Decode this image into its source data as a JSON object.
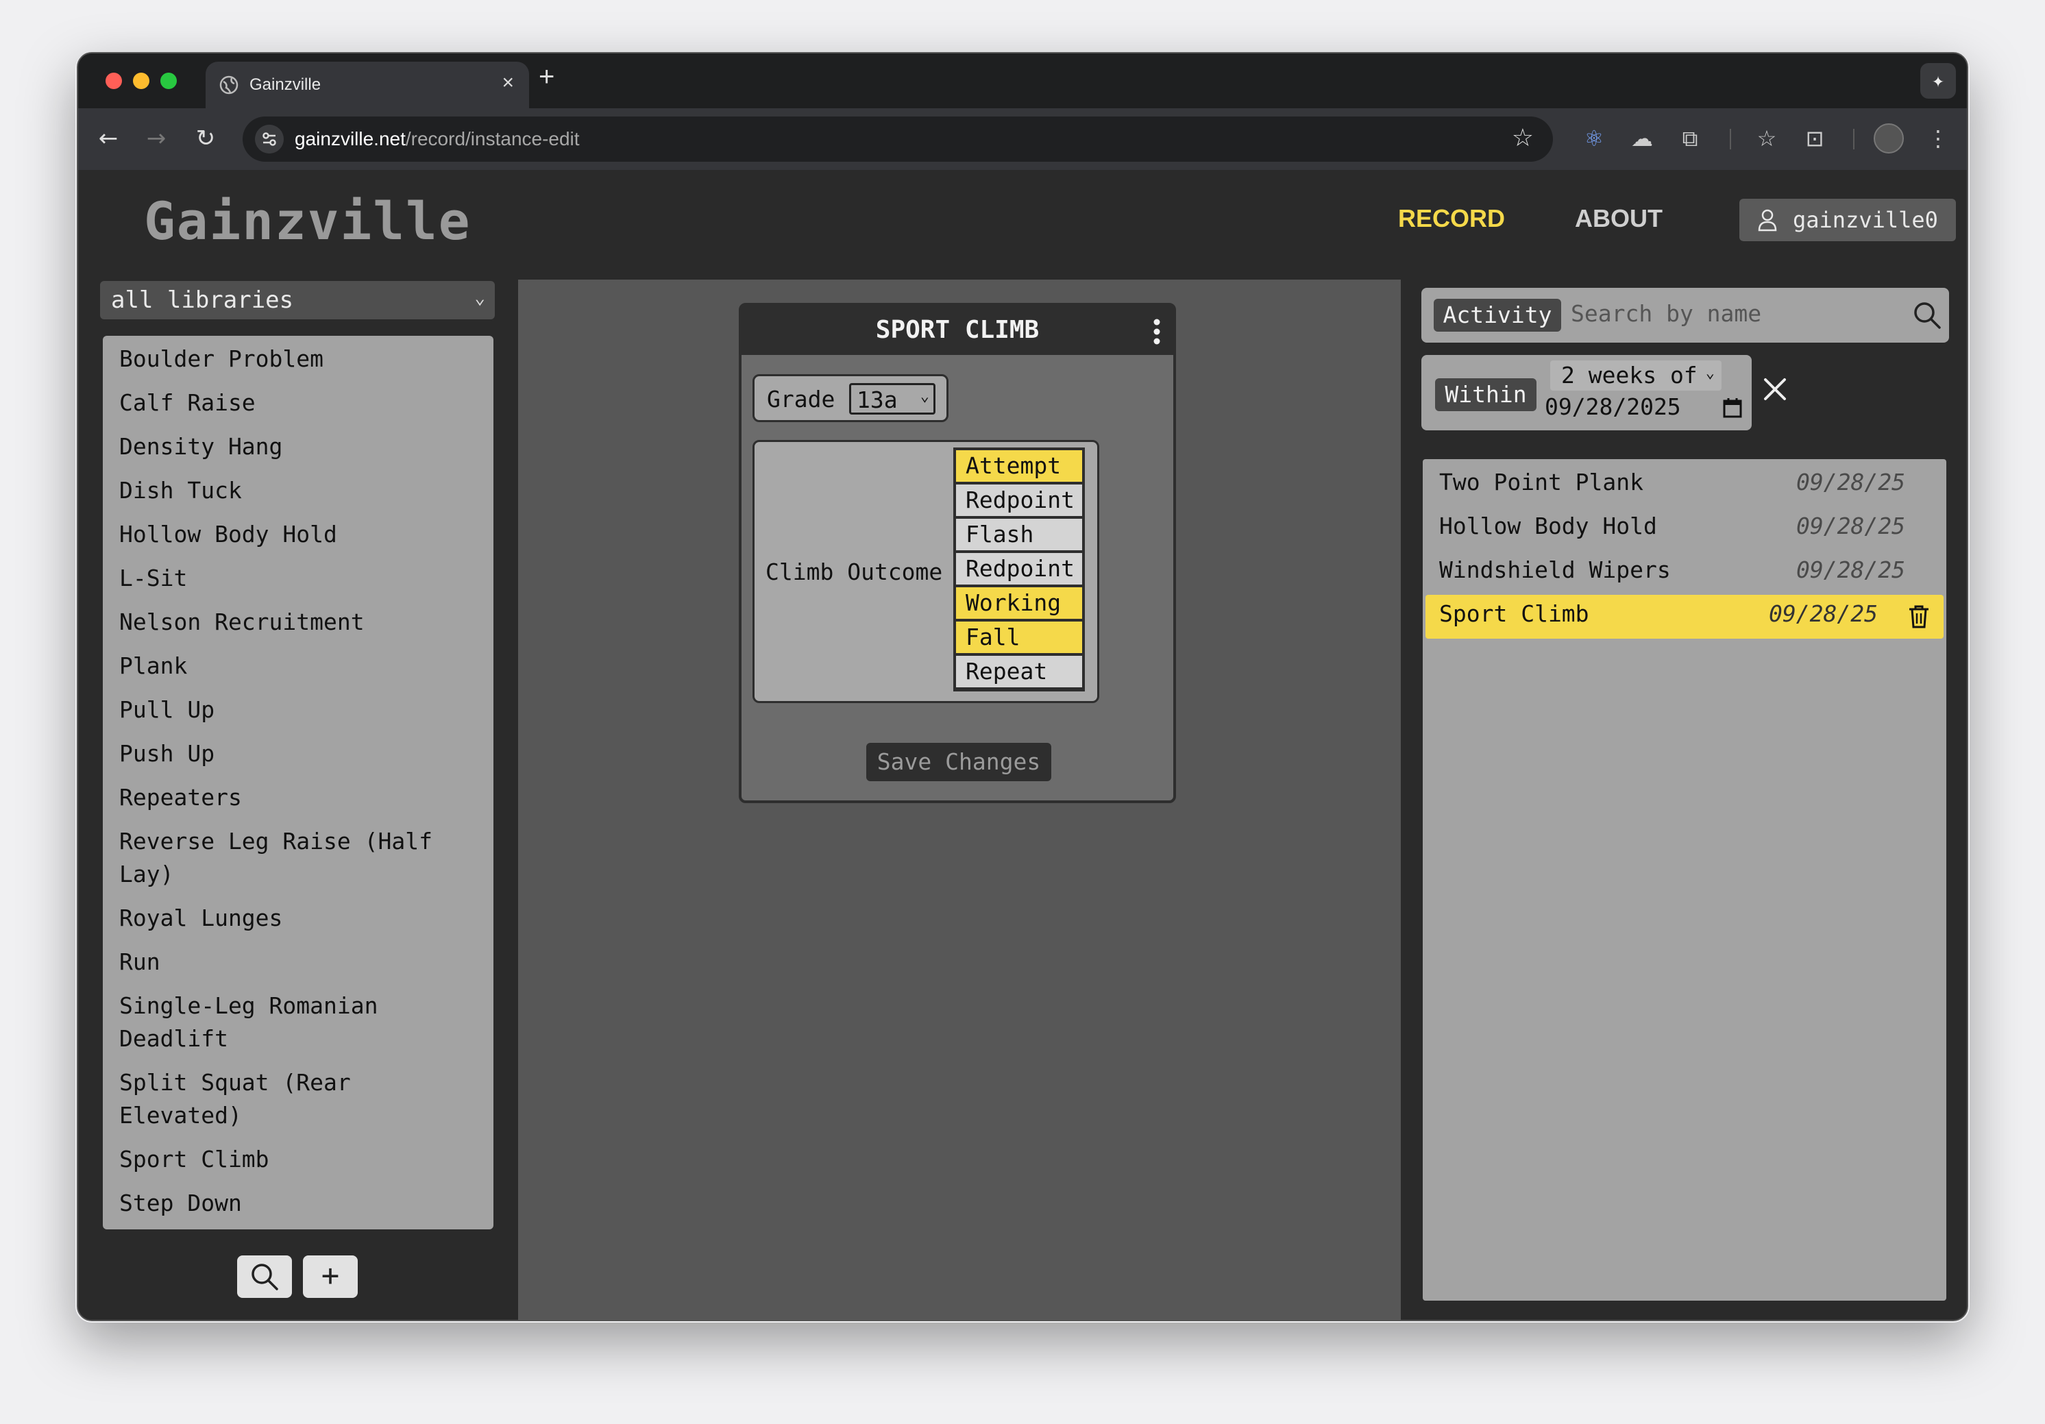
{
  "browser": {
    "tab_title": "Gainzville",
    "tab_close": "×",
    "new_tab": "+",
    "url_host": "gainzville.net",
    "url_path": "/record/instance-edit"
  },
  "header": {
    "brand": "Gainzville",
    "nav_record": "RECORD",
    "nav_about": "ABOUT",
    "username": "gainzville0"
  },
  "library": {
    "selected": "all libraries",
    "items": [
      "Boulder Problem",
      "Calf Raise",
      "Density Hang",
      "Dish Tuck",
      "Hollow Body Hold",
      "L-Sit",
      "Nelson Recruitment",
      "Plank",
      "Pull Up",
      "Push Up",
      "Repeaters",
      "Reverse Leg Raise (Half",
      "Lay)",
      "Royal Lunges",
      "Run",
      "Single-Leg Romanian",
      "Deadlift",
      "Split Squat (Rear",
      "Elevated)",
      "Sport Climb",
      "Step Down"
    ],
    "add_label": "+"
  },
  "editor": {
    "title": "SPORT CLIMB",
    "grade_label": "Grade",
    "grade_value": "13a",
    "outcome_label": "Climb Outcome",
    "outcomes": [
      {
        "label": "Attempt",
        "selected": true
      },
      {
        "label": "Redpoint",
        "selected": false
      },
      {
        "label": "Flash",
        "selected": false
      },
      {
        "label": "Redpoint",
        "selected": false
      },
      {
        "label": "Working",
        "selected": true
      },
      {
        "label": "Fall",
        "selected": true
      },
      {
        "label": "Repeat",
        "selected": false
      }
    ],
    "save_label": "Save Changes"
  },
  "filters": {
    "activity_chip": "Activity",
    "search_placeholder": "Search by name",
    "within_chip": "Within",
    "range_value": "2 weeks of",
    "date_value": "09/28/2025"
  },
  "recent": [
    {
      "name": "Two Point Plank",
      "date": "09/28/25",
      "selected": false
    },
    {
      "name": "Hollow Body Hold",
      "date": "09/28/25",
      "selected": false
    },
    {
      "name": "Windshield Wipers",
      "date": "09/28/25",
      "selected": false
    },
    {
      "name": "Sport Climb",
      "date": "09/28/25",
      "selected": true
    }
  ],
  "colors": {
    "accent": "#f5d94a",
    "panel": "#a3a3a3",
    "dark": "#2e2e2e"
  }
}
